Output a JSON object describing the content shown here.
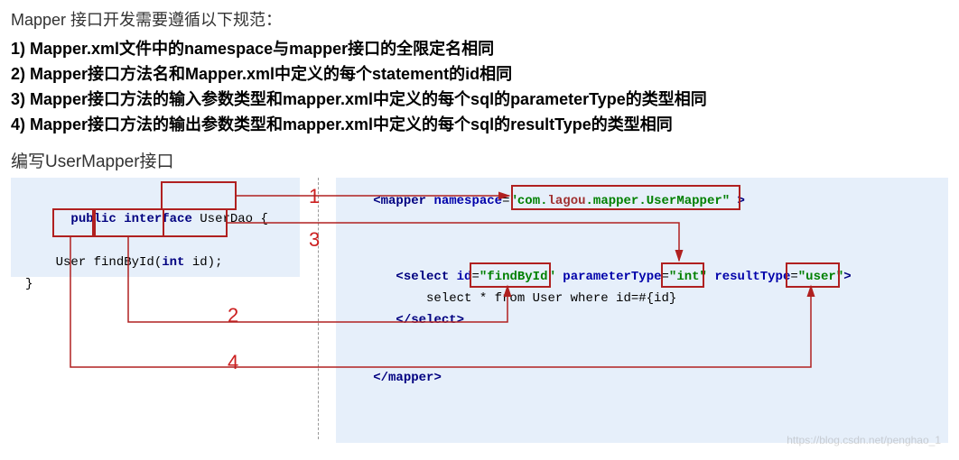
{
  "intro": "Mapper 接口开发需要遵循以下规范：",
  "rules": {
    "r1": "1) Mapper.xml文件中的namespace与mapper接口的全限定名相同",
    "r2": "2) Mapper接口方法名和Mapper.xml中定义的每个statement的id相同",
    "r3": "3) Mapper接口方法的输入参数类型和mapper.xml中定义的每个sql的parameterType的类型相同",
    "r4": "4) Mapper接口方法的输出参数类型和mapper.xml中定义的每个sql的resultType的类型相同"
  },
  "subtitle": "编写UserMapper接口",
  "java": {
    "public": "public",
    "interface": "interface",
    "class_name": " UserDao ",
    "brace": "{",
    "ret_type": "User",
    "method": " findById",
    "params_open": "(",
    "int": "int",
    "params_rest": " id);",
    "close": "}"
  },
  "xml": {
    "mapper_open": "<",
    "mapper_tag": "mapper",
    "namespace_attr": "namespace",
    "eq": "=",
    "namespace_open_quote": "\"",
    "namespace_val_pre": "com.",
    "namespace_val_mid": "lagou",
    "namespace_val_post": ".mapper.UserMapper",
    "namespace_close_quote": "\"",
    "gt": " >",
    "select_open": "<",
    "select_tag": "select",
    "id_attr": "id",
    "id_val": "\"findById\"",
    "param_attr": "parameterType",
    "param_val": "\"int\"",
    "result_attr": "resultType",
    "result_val": "\"user\"",
    "select_gt": ">",
    "sql_body": "select * from User where id=#{id}",
    "select_close": "</",
    "select_close_tag": "select",
    "select_close_gt": ">",
    "mapper_close": "</",
    "mapper_close_tag": "mapper",
    "mapper_close_gt": ">"
  },
  "labels": {
    "l1": "1",
    "l2": "2",
    "l3": "3",
    "l4": "4"
  },
  "watermark": "https://blog.csdn.net/penghao_1"
}
